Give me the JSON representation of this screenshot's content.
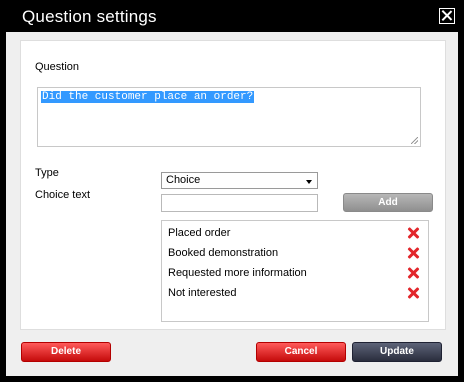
{
  "dialog": {
    "title": "Question settings"
  },
  "form": {
    "question_label": "Question",
    "question_value": "Did the customer place an order?",
    "type_label": "Type",
    "type_selected": "Choice",
    "choice_text_label": "Choice text",
    "choice_text_value": "",
    "add_label": "Add",
    "choices": [
      {
        "label": "Placed order"
      },
      {
        "label": "Booked demonstration"
      },
      {
        "label": "Requested more information"
      },
      {
        "label": "Not interested"
      }
    ]
  },
  "footer": {
    "delete_label": "Delete",
    "cancel_label": "Cancel",
    "update_label": "Update"
  },
  "colors": {
    "title_bar": "#000000",
    "panel": "#efefef",
    "accent_red": "#e2262b",
    "update_dark": "#2a2d3d",
    "selection_blue": "#3399ff"
  },
  "icons": {
    "close": "close-icon",
    "remove": "remove-icon",
    "dropdown": "chevron-down-icon"
  }
}
